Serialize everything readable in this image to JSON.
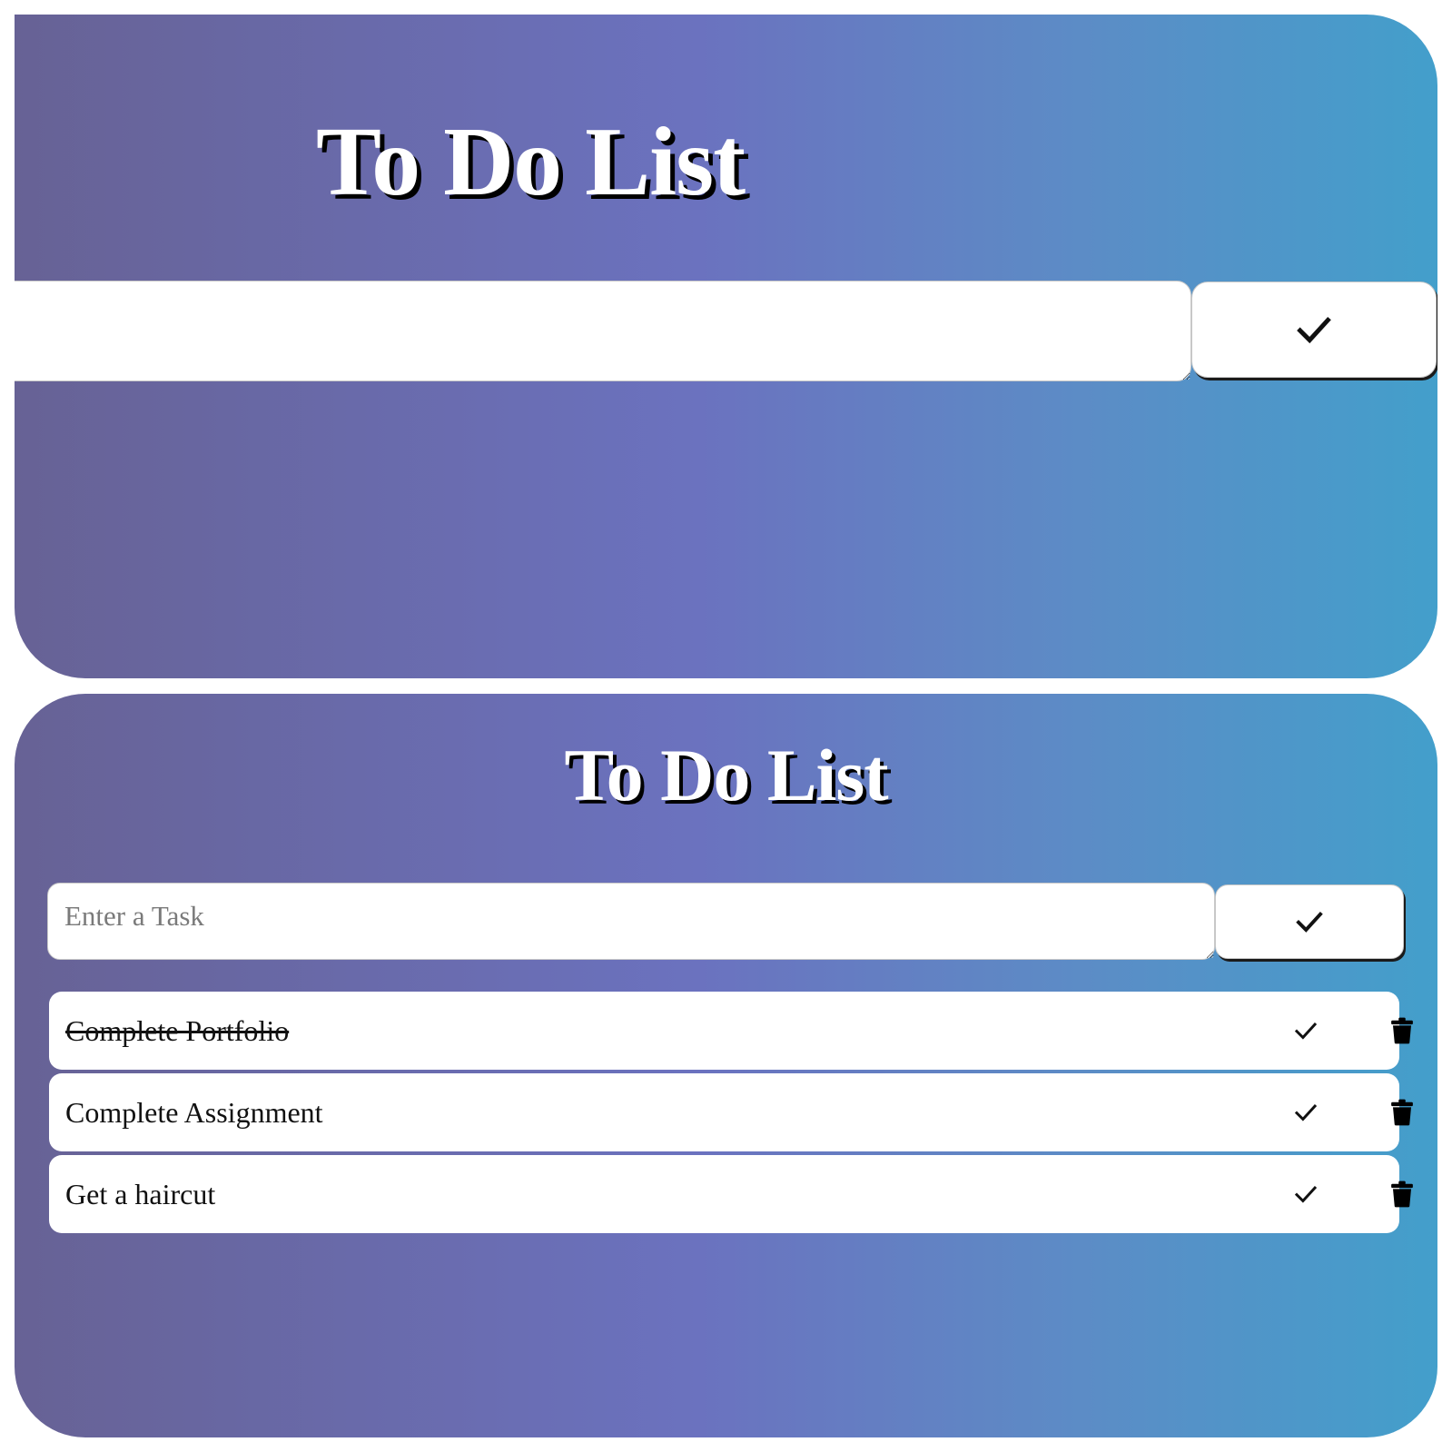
{
  "panels": [
    {
      "title": "To Do List",
      "input": {
        "value": "",
        "placeholder": ""
      },
      "add_button_icon": "check-icon",
      "tasks": []
    },
    {
      "title": "To Do List",
      "input": {
        "value": "",
        "placeholder": "Enter a Task"
      },
      "add_button_icon": "check-icon",
      "tasks": [
        {
          "text": "Complete Portfolio",
          "completed": true,
          "complete_icon": "check-icon",
          "delete_icon": "trash-icon"
        },
        {
          "text": "Complete Assignment",
          "completed": false,
          "complete_icon": "check-icon",
          "delete_icon": "trash-icon"
        },
        {
          "text": "Get a haircut",
          "completed": false,
          "complete_icon": "check-icon",
          "delete_icon": "trash-icon"
        }
      ]
    }
  ],
  "colors": {
    "gradient_left": "#676295",
    "gradient_middle": "#6b72bf",
    "gradient_right": "#439fcb",
    "title_text": "#ffffff",
    "title_shadow": "#000000",
    "item_background": "#ffffff"
  }
}
